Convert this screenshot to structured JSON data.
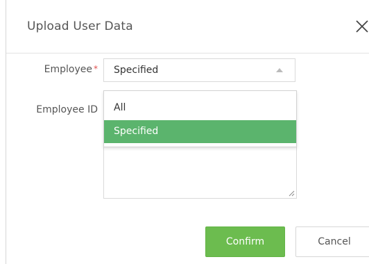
{
  "dialog": {
    "title": "Upload User Data",
    "close_icon": "close-icon"
  },
  "form": {
    "employee": {
      "label": "Employee",
      "required_marker": "*",
      "selected_value": "Specified",
      "caret_icon": "caret-up-icon"
    },
    "employee_id": {
      "label": "Employee ID",
      "value": ""
    }
  },
  "dropdown": {
    "options": [
      {
        "label": "All",
        "selected": false
      },
      {
        "label": "Specified",
        "selected": true
      }
    ]
  },
  "buttons": {
    "confirm_label": "Confirm",
    "cancel_label": "Cancel"
  },
  "colors": {
    "accent_green": "#6cbc4f",
    "selected_option": "#5bb46d",
    "required_star": "#e0504f"
  }
}
